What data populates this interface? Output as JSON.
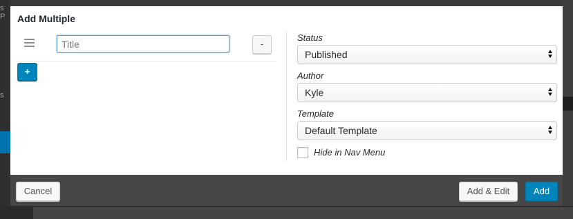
{
  "modal": {
    "title": "Add Multiple"
  },
  "rows": [
    {
      "title_value": "",
      "title_placeholder": "Title",
      "remove_label": "-"
    }
  ],
  "add_row_label": "+",
  "fields": {
    "status": {
      "label": "Status",
      "value": "Published"
    },
    "author": {
      "label": "Author",
      "value": "Kyle"
    },
    "template": {
      "label": "Template",
      "value": "Default Template"
    },
    "hide_in_nav": {
      "label": "Hide in Nav Menu",
      "checked": false
    }
  },
  "footer": {
    "cancel_label": "Cancel",
    "add_edit_label": "Add & Edit",
    "add_label": "Add"
  },
  "background": {
    "left_text_top": "s P",
    "left_text_mid": "s"
  },
  "colors": {
    "primary": "#0085ba",
    "overlay": "#3a3a3a",
    "footer": "#474747",
    "focus": "#5b9dd9"
  },
  "icons": {
    "drag": "drag-handle-icon",
    "select": "select-arrows-icon"
  }
}
